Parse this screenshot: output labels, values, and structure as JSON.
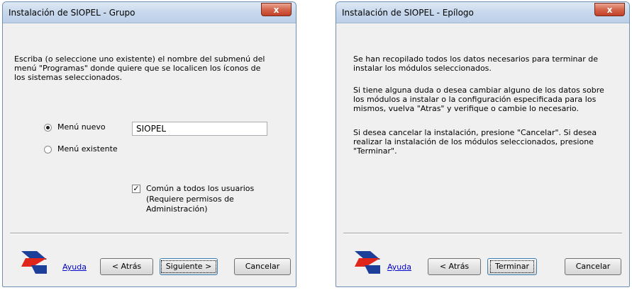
{
  "grupo": {
    "title": "Instalación de SIOPEL - Grupo",
    "close_label": "x",
    "description": "Escriba (o seleccione uno existente) el nombre del submenú del menú \"Programas\" donde quiere que se localicen los íconos de los sistemas seleccionados.",
    "radio_new_label": "Menú nuevo",
    "radio_existing_label": "Menú existente",
    "radio_selected": "Menú nuevo",
    "menu_name_value": "SIOPEL",
    "checkbox_label_line1": "Común a todos los usuarios",
    "checkbox_label_line2": "(Requiere permisos de",
    "checkbox_label_line3": "Administración)",
    "checkbox_checked": true,
    "help_link": "Ayuda",
    "back_button": "< Atrás",
    "next_button": "Siguiente >",
    "cancel_button": "Cancelar"
  },
  "epilogo": {
    "title": "Instalación de SIOPEL - Epílogo",
    "close_label": "x",
    "paragraph1": "Se han recopilado todos los datos necesarios para terminar de instalar los módulos seleccionados.",
    "paragraph2": "Si tiene alguna duda o desea cambiar alguno de los datos sobre los módulos a instalar o la configuración especificada para los mismos, vuelva \"Atras\" y verifique o cambie lo necesario.",
    "paragraph3": "Si desea cancelar la instalación, presione \"Cancelar\". Si desea realizar la instalación de los módulos seleccionados, presione \"Terminar\".",
    "help_link": "Ayuda",
    "back_button": "< Atrás",
    "finish_button": "Terminar",
    "cancel_button": "Cancelar"
  },
  "colors": {
    "logo_red": "#e0261b",
    "logo_blue": "#1d3f9a",
    "link_blue": "#0000cc",
    "close_red": "#c9482f"
  }
}
